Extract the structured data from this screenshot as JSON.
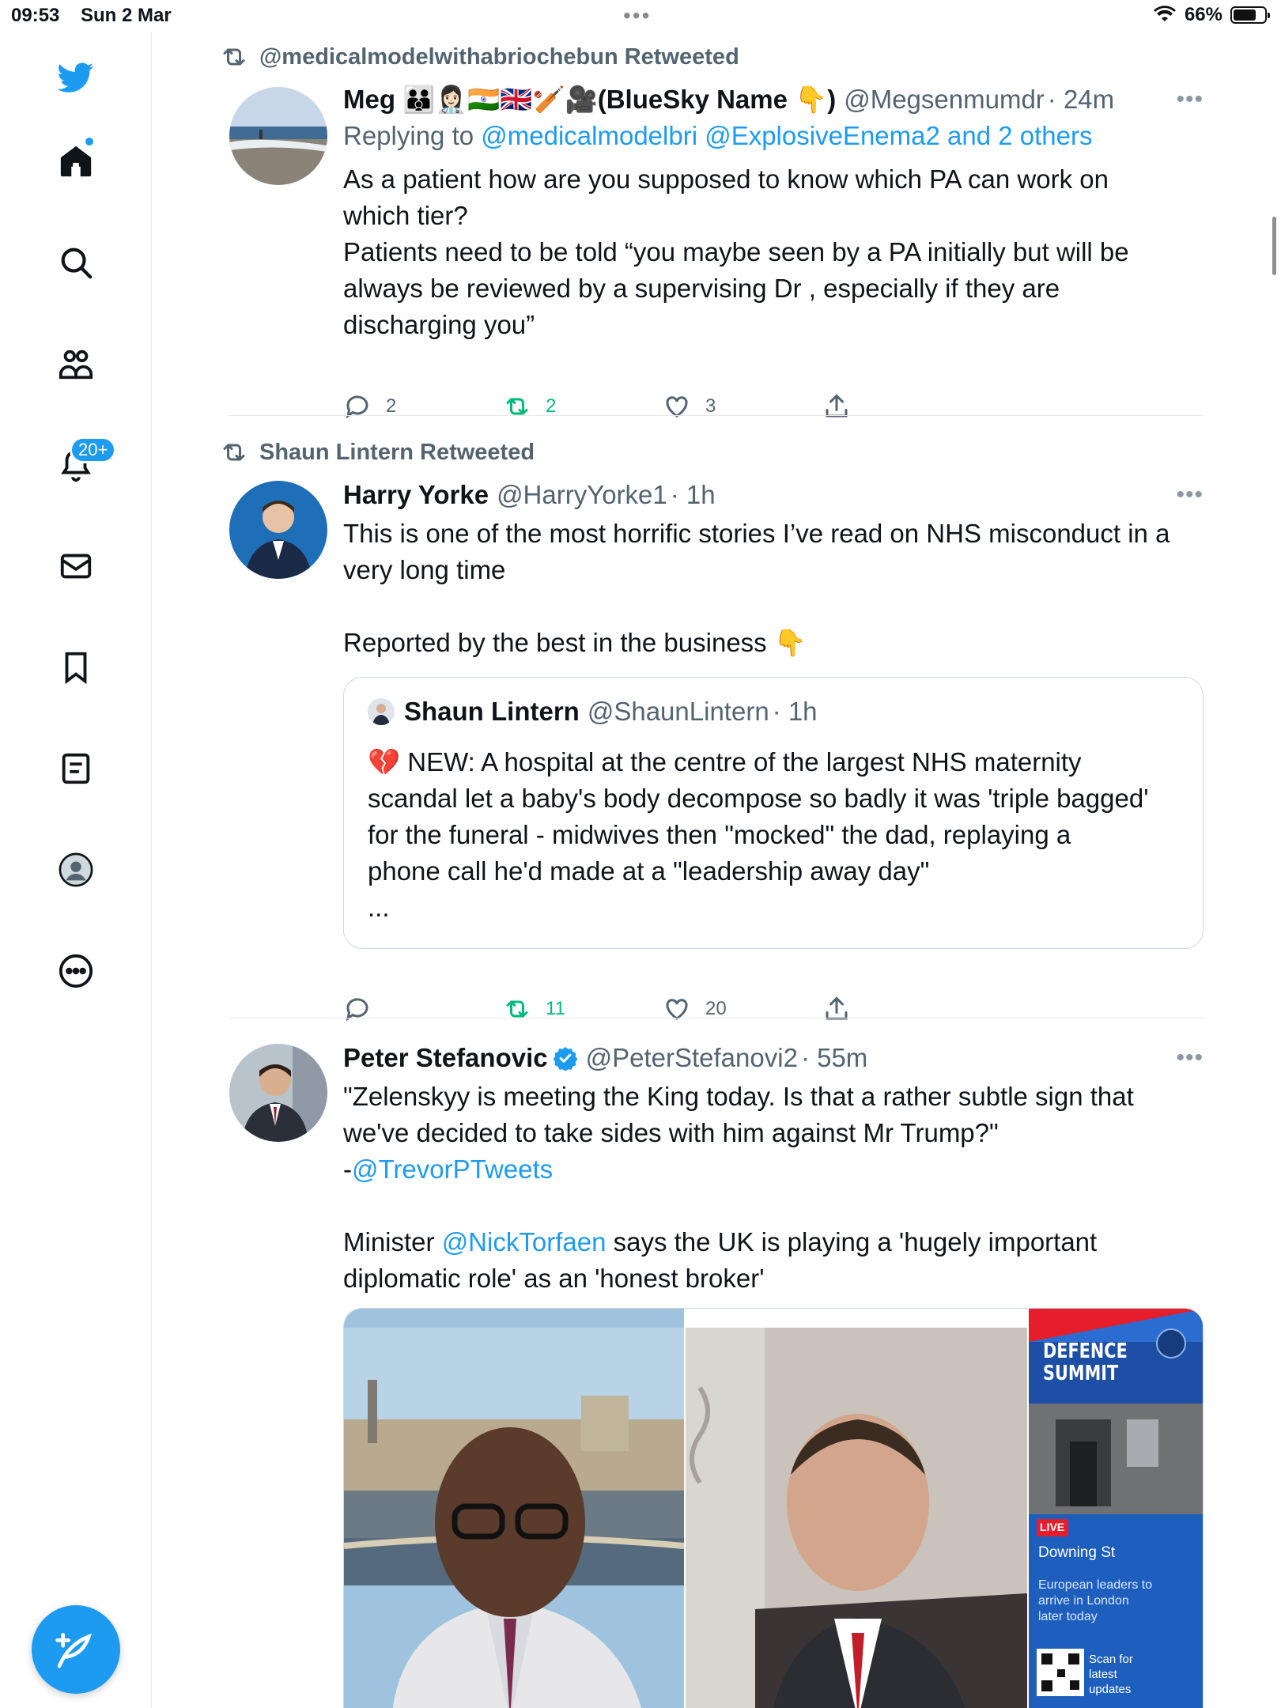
{
  "status_bar": {
    "time": "09:53",
    "date": "Sun 2 Mar",
    "battery": "66%"
  },
  "sidebar": {
    "items": [
      {
        "icon": "twitter-bird-icon"
      },
      {
        "icon": "home-icon"
      },
      {
        "icon": "search-icon"
      },
      {
        "icon": "communities-icon"
      },
      {
        "icon": "notifications-icon",
        "badge": "20+"
      },
      {
        "icon": "messages-icon"
      },
      {
        "icon": "bookmarks-icon"
      },
      {
        "icon": "lists-icon"
      },
      {
        "icon": "profile-icon"
      },
      {
        "icon": "more-icon"
      }
    ],
    "compose_icon": "compose-icon"
  },
  "tweets": [
    {
      "retweeted_by": "@medicalmodelwithabriochebun Retweeted",
      "name": "Meg 👪👩🏻‍⚕️🇮🇳🇬🇧🏏🎥(BlueSky Name 👇)",
      "handle": "@Megsenmumdr",
      "time": "· 24m",
      "reply_prefix": "Replying to ",
      "reply_targets": "@medicalmodelbri @ExplosiveEnema2 and 2 others",
      "text": [
        "As a patient how are you supposed to know which PA can work on",
        "which tier?",
        "Patients need to be told “you maybe seen by a PA initially but will be",
        "always be reviewed by a supervising Dr , especially if they are",
        "discharging you”"
      ],
      "replies": "2",
      "retweets": "2",
      "likes": "3"
    },
    {
      "retweeted_by": "Shaun Lintern Retweeted",
      "name": "Harry Yorke",
      "handle": "@HarryYorke1",
      "time": "· 1h",
      "text": [
        "This is one of the most horrific stories I’ve read on NHS misconduct in a",
        "very long time",
        "",
        "Reported by the best in the business 👇"
      ],
      "quote": {
        "name": "Shaun Lintern",
        "handle": "@ShaunLintern",
        "time": "· 1h",
        "text": [
          "💔 NEW: A hospital at the centre of the largest NHS maternity",
          "scandal let a baby's body decompose so badly it was 'triple bagged'",
          "for the funeral - midwives then \"mocked\" the dad, replaying a",
          "phone call he'd made at a \"leadership away day\"",
          "..."
        ]
      },
      "replies": "",
      "retweets": "11",
      "likes": "20"
    },
    {
      "name": "Peter Stefanovic",
      "handle": "@PeterStefanovi2",
      "time": "· 55m",
      "verified": true,
      "text_lines": [
        "\"Zelenskyy is meeting the King today. Is that a rather subtle sign that",
        "we've decided to take sides with him against Mr Trump?\""
      ],
      "mention_prefix": "-",
      "mention": "@TrevorPTweets",
      "text2_prefix": "Minister ",
      "text2_mention": "@NickTorfaen",
      "text2_rest": " says the UK is playing a 'hugely important",
      "text2_line2": "diplomatic role' as an 'honest broker'",
      "media": {
        "banner_title_1": "DEFENCE",
        "banner_title_2": "SUMMIT",
        "live_badge": "LIVE",
        "location": "Downing St",
        "caption": [
          "European leaders to",
          "arrive in London",
          "later today"
        ],
        "qr_text": [
          "Scan for",
          "latest",
          "updates"
        ]
      }
    }
  ],
  "colors": {
    "accent": "#1d9bf0",
    "retweet_green": "#00ba7c",
    "secondary_text": "#536471"
  }
}
